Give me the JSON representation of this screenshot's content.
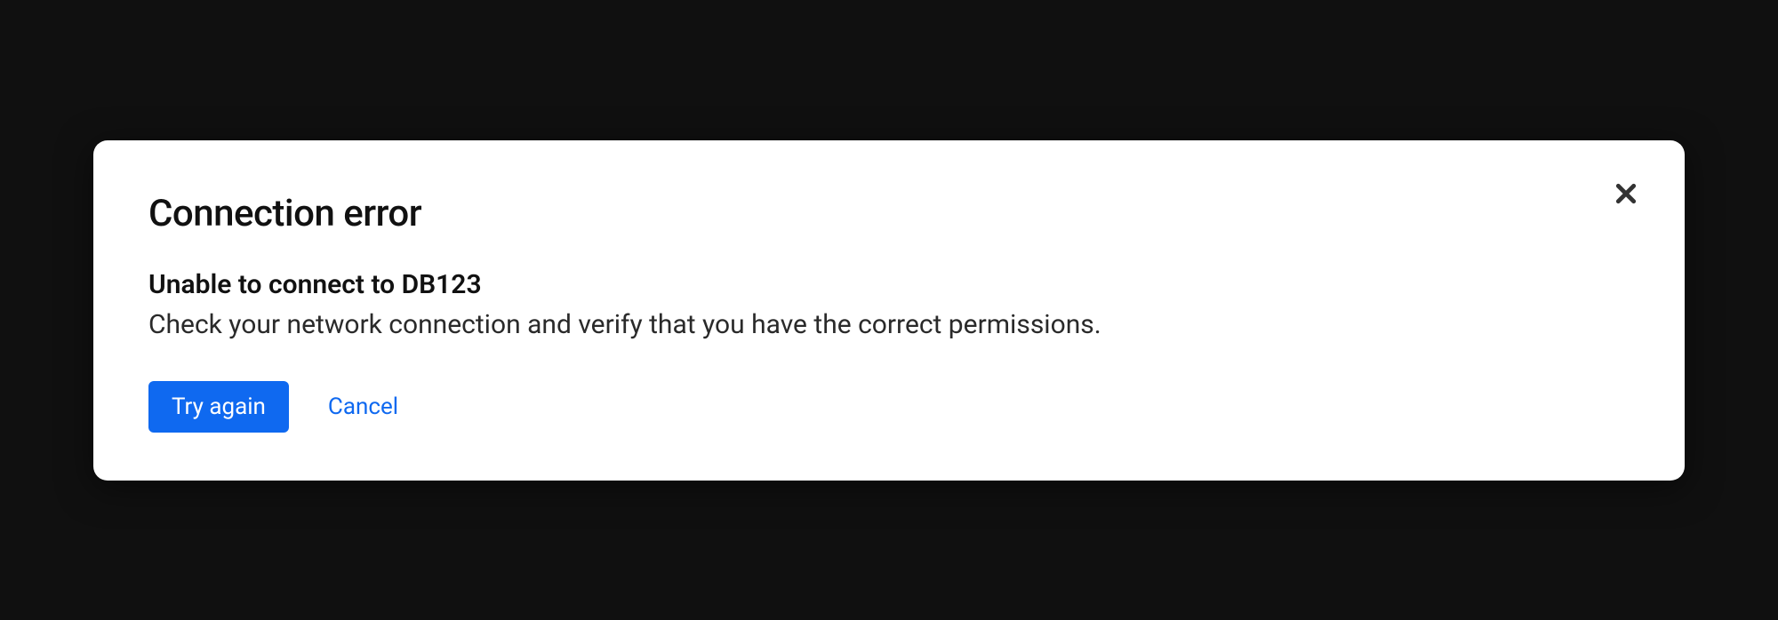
{
  "dialog": {
    "title": "Connection error",
    "subtitle": "Unable to connect to DB123",
    "description": "Check your network connection and verify that you have the correct permissions.",
    "primary_action_label": "Try again",
    "secondary_action_label": "Cancel"
  },
  "colors": {
    "background": "#101010",
    "dialog_bg": "#ffffff",
    "primary_button": "#0F69F0",
    "text_primary": "#111111",
    "close_icon": "#333333"
  }
}
